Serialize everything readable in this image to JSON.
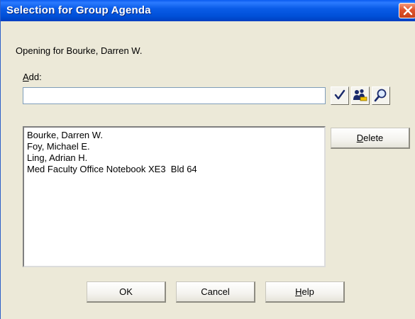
{
  "window": {
    "title": "Selection for Group Agenda",
    "close_icon": "close-icon"
  },
  "dialog": {
    "opening_text": "Opening for Bourke, Darren W.",
    "add_label_prefix": "",
    "add_label_mnemonic": "A",
    "add_label_rest": "dd:",
    "add_input_value": "",
    "tool_buttons": [
      {
        "name": "check-names-button",
        "icon": "checkmark-icon"
      },
      {
        "name": "address-book-button",
        "icon": "people-icon"
      },
      {
        "name": "search-button",
        "icon": "magnifier-icon"
      }
    ],
    "attendees": [
      "Bourke, Darren W.",
      "Foy, Michael E.",
      "Ling, Adrian H.",
      "Med Faculty Office Notebook XE3  Bld 64"
    ],
    "delete_button": {
      "mnemonic": "D",
      "rest": "elete"
    },
    "ok_button": "OK",
    "cancel_button": "Cancel",
    "help_button": {
      "mnemonic": "H",
      "rest": "elp"
    }
  },
  "colors": {
    "titlebar": "#0a5ce8",
    "dialog_bg": "#ece9d8",
    "close_button": "#e0532c"
  }
}
